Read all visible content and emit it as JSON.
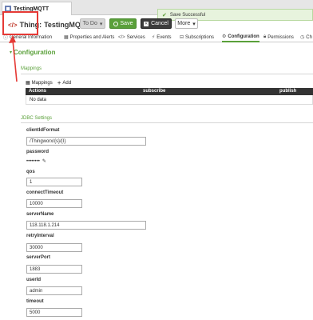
{
  "browser": {
    "tab_title": "TestingMQTT"
  },
  "toast": {
    "message": "Save Successful"
  },
  "header": {
    "thing_prefix": "Thing:",
    "thing_name": "TestingMQTT",
    "todo_label": "To Do",
    "save_label": "Save",
    "cancel_label": "Cancel",
    "more_label": "More"
  },
  "tabs": [
    {
      "label": "General Information"
    },
    {
      "label": "Properties and Alerts"
    },
    {
      "label": "Services"
    },
    {
      "label": "Events"
    },
    {
      "label": "Subscriptions"
    },
    {
      "label": "Configuration"
    },
    {
      "label": "Permissions"
    },
    {
      "label": "Ch"
    }
  ],
  "config": {
    "heading": "Configuration",
    "mappings_section": "Mappings",
    "mappings_tool": "Mappings",
    "add_label": "Add",
    "columns": [
      "Actions",
      "subscribe",
      "publish"
    ],
    "empty_text": "No data",
    "jdbc_section": "JDBC Settings"
  },
  "fields": {
    "clientIdFormat": {
      "label": "clientIdFormat",
      "value": "/Thingworx/{s}/{I}"
    },
    "password": {
      "label": "password",
      "value": "••••••••"
    },
    "qos": {
      "label": "qos",
      "value": "1"
    },
    "connectTimeout": {
      "label": "connectTimeout",
      "value": "10000"
    },
    "serverName": {
      "label": "serverName",
      "value": "118.118.1.214"
    },
    "retryInterval": {
      "label": "retryInterval",
      "value": "30000"
    },
    "serverPort": {
      "label": "serverPort",
      "value": "1883"
    },
    "userId": {
      "label": "userId",
      "value": "admin"
    },
    "timeout": {
      "label": "timeout",
      "value": "5000"
    }
  },
  "colors": {
    "accent": "#5aa03a",
    "annotation": "#e53935",
    "grid_header": "#333333"
  }
}
